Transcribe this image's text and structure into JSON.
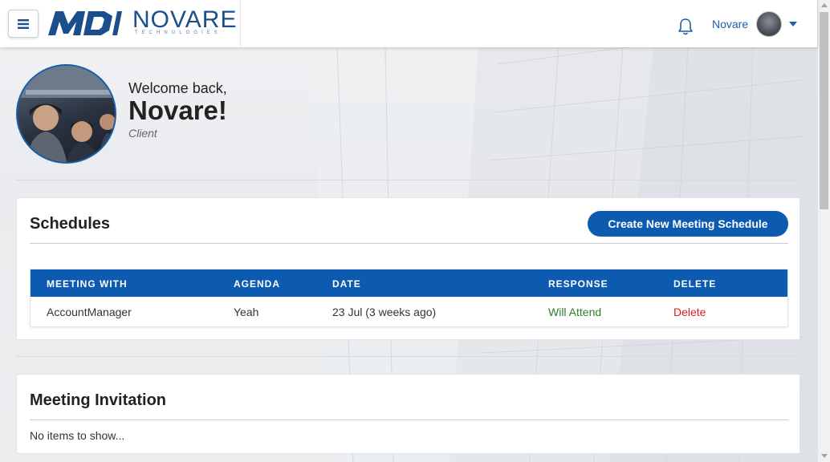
{
  "header": {
    "brand_mdi": "MDI",
    "brand_name": "NOVARE",
    "brand_sub": "TECHNOLOGIES",
    "user_name": "Novare",
    "icons": [
      "menu-icon",
      "bell-icon",
      "avatar",
      "caret-down-icon"
    ]
  },
  "profile": {
    "welcome": "Welcome back,",
    "name": "Novare!",
    "role": "Client"
  },
  "schedules": {
    "title": "Schedules",
    "create_button": "Create New Meeting Schedule",
    "columns": [
      "MEETING WITH",
      "AGENDA",
      "DATE",
      "RESPONSE",
      "DELETE"
    ],
    "rows": [
      {
        "meeting_with": "AccountManager",
        "agenda": "Yeah",
        "date": "23 Jul (3 weeks ago)",
        "response": "Will Attend",
        "delete": "Delete"
      }
    ]
  },
  "invitation": {
    "title": "Meeting Invitation",
    "empty": "No items to show..."
  },
  "colors": {
    "primary": "#0d5bb0",
    "accent_text": "#1b5fa8",
    "response_green": "#2a7d2a",
    "delete_red": "#d61f1f"
  }
}
